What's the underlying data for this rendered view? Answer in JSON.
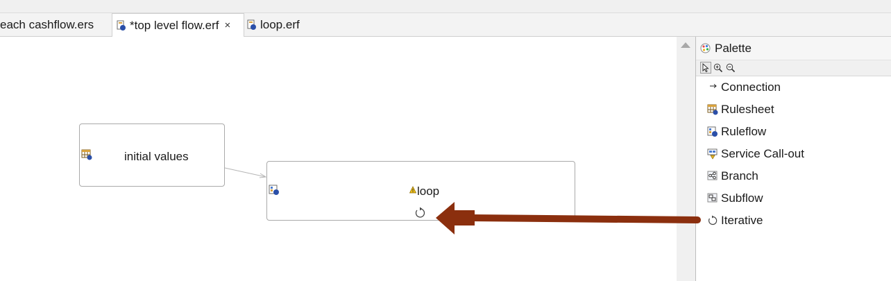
{
  "editor_tabs": [
    {
      "label": "each cashflow.ers",
      "active": false
    },
    {
      "label": "*top level flow.erf",
      "active": true,
      "close": "×"
    },
    {
      "label": "loop.erf",
      "active": false
    }
  ],
  "palette": {
    "title": "Palette",
    "tools": [
      "select-tool",
      "zoom-in-tool",
      "zoom-out-tool"
    ],
    "items": [
      {
        "label": "Connection",
        "icon": "connection-arrow-icon"
      },
      {
        "label": "Rulesheet",
        "icon": "rulesheet-icon"
      },
      {
        "label": "Ruleflow",
        "icon": "ruleflow-icon"
      },
      {
        "label": "Service Call-out",
        "icon": "service-callout-icon"
      },
      {
        "label": "Branch",
        "icon": "branch-icon"
      },
      {
        "label": "Subflow",
        "icon": "subflow-icon"
      },
      {
        "label": "Iterative",
        "icon": "iterative-icon"
      }
    ]
  },
  "canvas": {
    "nodes": {
      "initial": {
        "label": "initial values",
        "icon": "rulesheet-icon"
      },
      "loop": {
        "label": "loop",
        "icon": "ruleflow-icon",
        "badge": "warning-icon",
        "marker": "iterative-icon"
      }
    },
    "connection": {
      "from": "initial values",
      "to": "loop"
    }
  },
  "annotation": {
    "color": "#8b2f0e",
    "meaning": "drag Iterative onto loop"
  }
}
